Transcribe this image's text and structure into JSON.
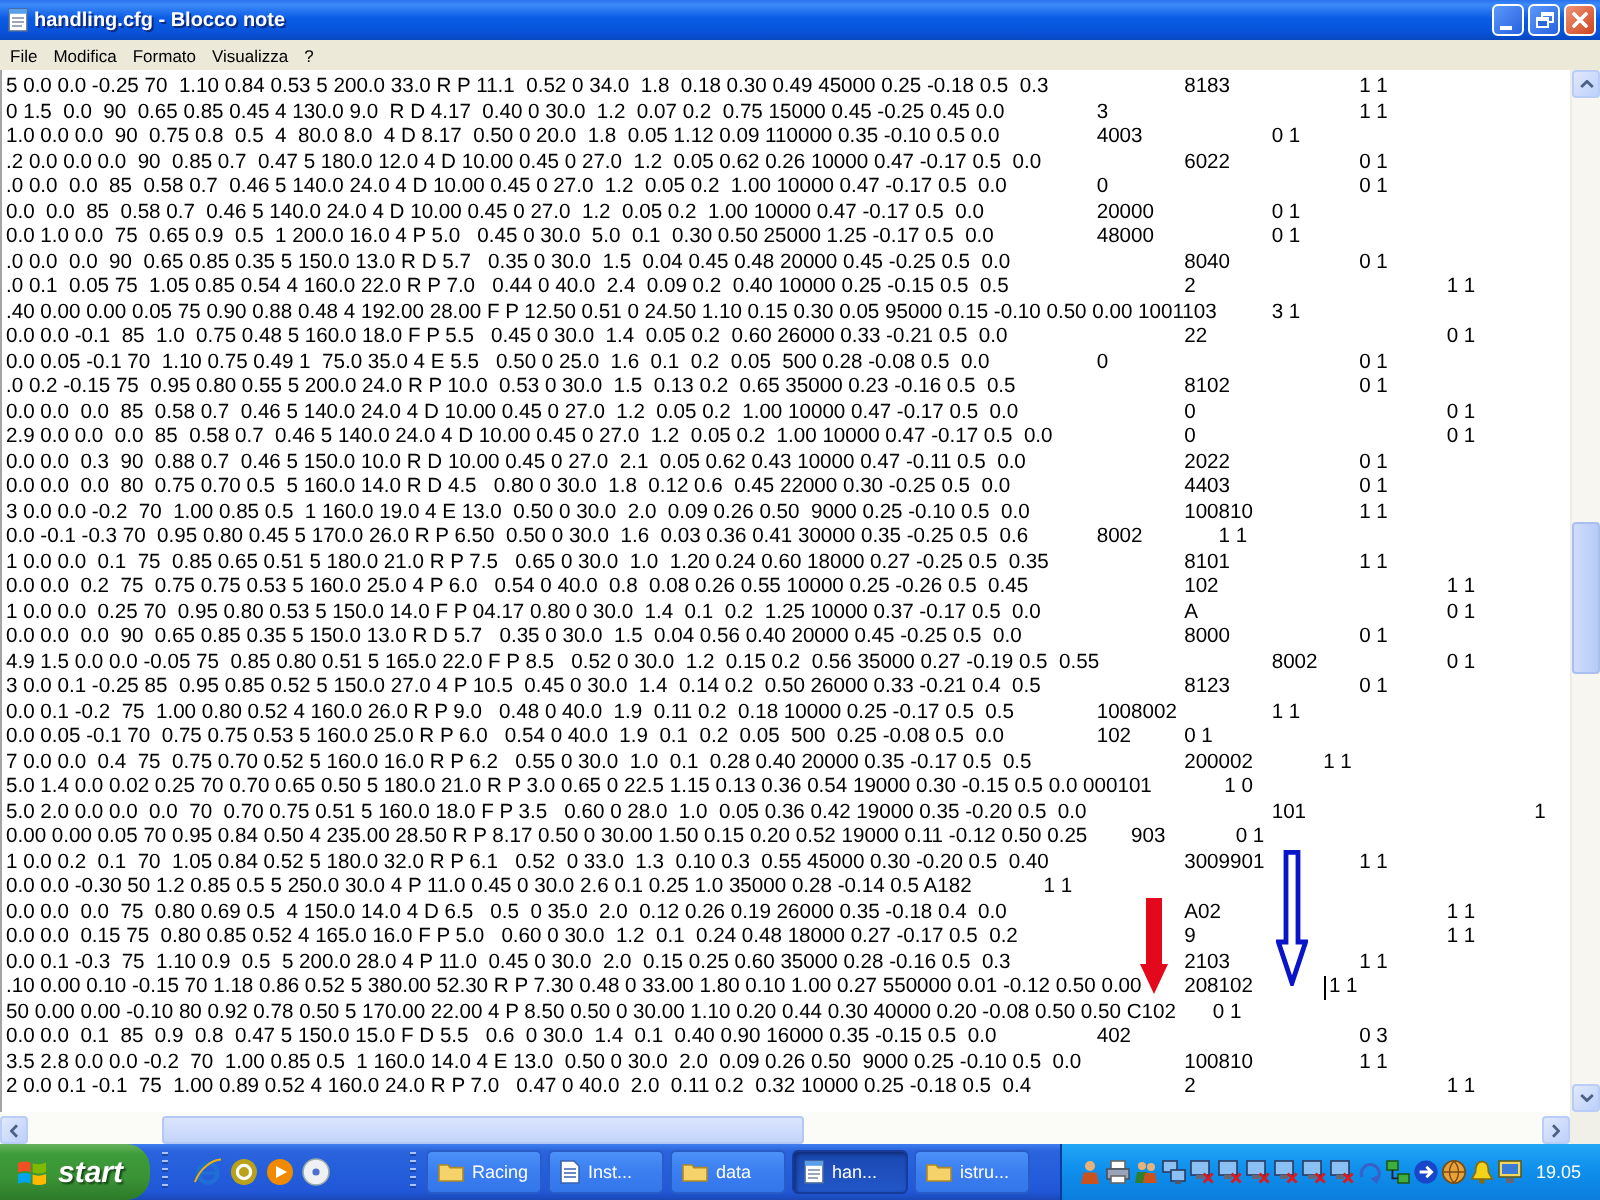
{
  "window": {
    "title": "handling.cfg - Blocco note"
  },
  "menu": [
    "File",
    "Modifica",
    "Formato",
    "Visualizza",
    "?"
  ],
  "lines": [
    {
      "text": "5 0.0 0.0 -0.25 70  1.10 0.84 0.53 5 200.0 33.0 R P 11.1  0.52 0 34.0  1.8  0.18 0.30 0.49 45000 0.25 -0.18 0.5  0.3\t\t8183\t\t1 1",
      "caret": false
    },
    {
      "text": "0 1.5  0.0  90  0.65 0.85 0.45 4 130.0 9.0  R D 4.17  0.40 0 30.0  1.2  0.07 0.2  0.75 15000 0.45 -0.25 0.45 0.0\t\t3\t\t\t1 1",
      "caret": false
    },
    {
      "text": "1.0 0.0 0.0  90  0.75 0.8  0.5  4  80.0 8.0  4 D 8.17  0.50 0 20.0  1.8  0.05 1.12 0.09 110000 0.35 -0.10 0.5 0.0\t\t4003\t\t0 1",
      "caret": false
    },
    {
      "text": ".2 0.0 0.0 0.0  90  0.85 0.7  0.47 5 180.0 12.0 4 D 10.00 0.45 0 27.0  1.2  0.05 0.62 0.26 10000 0.47 -0.17 0.5  0.0\t\t6022\t\t0 1",
      "caret": false
    },
    {
      "text": ".0 0.0  0.0  85  0.58 0.7  0.46 5 140.0 24.0 4 D 10.00 0.45 0 27.0  1.2  0.05 0.2  1.00 10000 0.47 -0.17 0.5  0.0\t\t0\t\t\t0 1",
      "caret": false
    },
    {
      "text": "0.0  0.0  85  0.58 0.7  0.46 5 140.0 24.0 4 D 10.00 0.45 0 27.0  1.2  0.05 0.2  1.00 10000 0.47 -0.17 0.5  0.0\t\t20000\t\t0 1",
      "caret": false
    },
    {
      "text": "0.0 1.0 0.0  75  0.65 0.9  0.5  1 200.0 16.0 4 P 5.0   0.45 0 30.0  5.0  0.1  0.30 0.50 25000 1.25 -0.17 0.5  0.0\t\t48000\t\t0 1",
      "caret": false
    },
    {
      "text": ".0 0.0  0.0  90  0.65 0.85 0.35 5 150.0 13.0 R D 5.7   0.35 0 30.0  1.5  0.04 0.45 0.48 20000 0.45 -0.25 0.5  0.0\t\t8040\t\t0 1",
      "caret": false
    },
    {
      "text": ".0 0.1  0.05 75  1.05 0.85 0.54 4 160.0 22.0 R P 7.0   0.44 0 40.0  2.4  0.09 0.2  0.40 10000 0.25 -0.15 0.5  0.5\t\t2\t\t\t1 1",
      "caret": false
    },
    {
      "text": ".40 0.00 0.00 0.05 75 0.90 0.88 0.48 4 192.00 28.00 F P 12.50 0.51 0 24.50 1.10 0.15 0.30 0.05 95000 0.15 -0.10 0.50 0.00 1001103\t3 1",
      "caret": false
    },
    {
      "text": "0.0 0.0 -0.1  85  1.0  0.75 0.48 5 160.0 18.0 F P 5.5   0.45 0 30.0  1.4  0.05 0.2  0.60 26000 0.33 -0.21 0.5  0.0\t\t\t22\t\t\t0 1",
      "caret": false
    },
    {
      "text": "0.0 0.05 -0.1 70  1.10 0.75 0.49 1  75.0 35.0 4 E 5.5   0.50 0 25.0  1.6  0.1  0.2  0.05  500 0.28 -0.08 0.5  0.0\t\t0\t\t\t0 1",
      "caret": false
    },
    {
      "text": ".0 0.2 -0.15 75  0.95 0.80 0.55 5 200.0 24.0 R P 10.0  0.53 0 30.0  1.5  0.13 0.2  0.65 35000 0.23 -0.16 0.5  0.5\t\t8102\t\t0 1",
      "caret": false
    },
    {
      "text": "0.0 0.0  0.0  85  0.58 0.7  0.46 5 140.0 24.0 4 D 10.00 0.45 0 27.0  1.2  0.05 0.2  1.00 10000 0.47 -0.17 0.5  0.0\t\t0\t\t\t0 1",
      "caret": false
    },
    {
      "text": "2.9 0.0 0.0  0.0  85  0.58 0.7  0.46 5 140.0 24.0 4 D 10.00 0.45 0 27.0  1.2  0.05 0.2  1.00 10000 0.47 -0.17 0.5  0.0\t\t0\t\t\t0 1",
      "caret": false
    },
    {
      "text": "0.0 0.0  0.3  90  0.88 0.7  0.46 5 150.0 10.0 R D 10.00 0.45 0 27.0  2.1  0.05 0.62 0.43 10000 0.47 -0.11 0.5  0.0\t\t2022\t\t0 1",
      "caret": false
    },
    {
      "text": "0.0 0.0  0.0  80  0.75 0.70 0.5  5 160.0 14.0 R D 4.5   0.80 0 30.0  1.8  0.12 0.6  0.45 22000 0.30 -0.25 0.5  0.0\t\t4403\t\t0 1",
      "caret": false
    },
    {
      "text": "3 0.0 0.0 -0.2  70  1.00 0.85 0.5  1 160.0 19.0 4 E 13.0  0.50 0 30.0  2.0  0.09 0.26 0.50  9000 0.25 -0.10 0.5  0.0\t\t100810\t\t1 1",
      "caret": false
    },
    {
      "text": "0.0 -0.1 -0.3 70  0.95 0.80 0.45 5 170.0 26.0 R P 6.50  0.50 0 30.0  1.6  0.03 0.36 0.41 30000 0.35 -0.25 0.5  0.6\t8002\t      1 1",
      "caret": false
    },
    {
      "text": "1 0.0 0.0  0.1  75  0.85 0.65 0.51 5 180.0 21.0 R P 7.5   0.65 0 30.0  1.0  1.20 0.24 0.60 18000 0.27 -0.25 0.5  0.35\t\t8101\t\t1 1",
      "caret": false
    },
    {
      "text": "0.0 0.0  0.2  75  0.75 0.75 0.53 5 160.0 25.0 4 P 6.0   0.54 0 40.0  0.8  0.08 0.26 0.55 10000 0.25 -0.26 0.5  0.45\t\t102\t\t\t1 1",
      "caret": false
    },
    {
      "text": "1 0.0 0.0  0.25 70  0.95 0.80 0.53 5 150.0 14.0 F P 04.17 0.80 0 30.0  1.4  0.1  0.2  1.25 10000 0.37 -0.17 0.5  0.0\t\tA\t\t\t0 1",
      "caret": false
    },
    {
      "text": "0.0 0.0  0.0  90  0.65 0.85 0.35 5 150.0 13.0 R D 5.7   0.35 0 30.0  1.5  0.04 0.56 0.40 20000 0.45 -0.25 0.5  0.0\t\t8000\t\t0 1",
      "caret": false
    },
    {
      "text": "4.9 1.5 0.0 0.0 -0.05 75  0.85 0.80 0.51 5 165.0 22.0 F P 8.5   0.52 0 30.0  1.2  0.15 0.2  0.56 35000 0.27 -0.19 0.5  0.55\t\t8002\t\t0 1",
      "caret": false
    },
    {
      "text": "3 0.0 0.1 -0.25 85  0.95 0.85 0.52 5 150.0 27.0 4 P 10.5  0.45 0 30.0  1.4  0.14 0.2  0.50 26000 0.33 -0.21 0.4  0.5\t\t8123\t\t0 1",
      "caret": false
    },
    {
      "text": "0.0 0.1 -0.2  75  1.00 0.80 0.52 4 160.0 26.0 R P 9.0   0.48 0 40.0  1.9  0.11 0.2  0.18 10000 0.25 -0.17 0.5  0.5\t1008002\t\t1 1",
      "caret": false
    },
    {
      "text": "0.0 0.05 -0.1 70  0.75 0.75 0.53 5 160.0 25.0 R P 6.0   0.54 0 40.0  1.9  0.1  0.2  0.05  500  0.25 -0.08 0.5  0.0\t\t102\t0 1",
      "caret": false
    },
    {
      "text": "7 0.0 0.0  0.4  75  0.75 0.70 0.52 5 160.0 16.0 R P 6.2   0.55 0 30.0  1.0  0.1  0.28 0.40 20000 0.35 -0.17 0.5  0.5\t\t200002\t         1 1",
      "caret": false
    },
    {
      "text": "5.0 1.4 0.0 0.02 0.25 70 0.70 0.65 0.50 5 180.0 21.0 R P 3.0 0.65 0 22.5 1.15 0.13 0.36 0.54 19000 0.30 -0.15 0.5 0.0 000101\t       1 0",
      "caret": false
    },
    {
      "text": "5.0 2.0 0.0 0.0  0.0  70  0.70 0.75 0.51 5 160.0 18.0 F P 3.5   0.60 0 28.0  1.0  0.05 0.36 0.42 19000 0.35 -0.20 0.5  0.0\t\t\t101\t\t\t1",
      "caret": false
    },
    {
      "text": "0.00 0.00 0.05 70 0.95 0.84 0.50 4 235.00 28.50 R P 8.17 0.50 0 30.00 1.50 0.15 0.20 0.52 19000 0.11 -0.12 0.50 0.25\t      903\t         0 1",
      "caret": false
    },
    {
      "text": "1 0.0 0.2  0.1  70  1.05 0.84 0.52 5 180.0 32.0 R P 6.1   0.52  0 33.0  1.3  0.10 0.3  0.55 45000 0.30 -0.20 0.5  0.40\t\t3009901\t\t1 1",
      "caret": false
    },
    {
      "text": "0.0 0.0 -0.30 50 1.2 0.85 0.5 5 250.0 30.0 4 P 11.0 0.45 0 30.0 2.6 0.1 0.25 1.0 35000 0.28 -0.14 0.5 A182\t      1 1",
      "caret": false
    },
    {
      "text": "0.0 0.0  0.0  75  0.80 0.69 0.5  4 150.0 14.0 4 D 6.5   0.5  0 35.0  2.0  0.12 0.26 0.19 26000 0.35 -0.18 0.4  0.0\t\t\tA02\t\t\t1 1",
      "caret": false
    },
    {
      "text": "0.0 0.0  0.15 75  0.80 0.85 0.52 4 165.0 16.0 F P 5.0   0.60 0 30.0  1.2  0.1  0.24 0.48 18000 0.27 -0.17 0.5  0.2\t\t9\t\t\t1 1",
      "caret": false
    },
    {
      "text": "0.0 0.1 -0.3  75  1.10 0.9  0.5  5 200.0 28.0 4 P 11.0  0.45 0 30.0  2.0  0.15 0.25 0.60 35000 0.28 -0.16 0.5  0.3\t\t2103\t\t1 1",
      "caret": false
    },
    {
      "text": ".10 0.00 0.10 -0.15 70 1.18 0.86 0.52 5 380.00 52.30 R P 7.30 0.48 0 33.00 1.80 0.10 1.00 0.27 550000 0.01 -0.12 0.50 0.00\t208102\t          1 1",
      "caret": true
    },
    {
      "text": "50 0.00 0.00 -0.10 80 0.92 0.78 0.50 5 170.00 22.00 4 P 8.50 0.50 0 30.00 1.10 0.20 0.44 0.30 40000 0.20 -0.08 0.50 0.50 C102\t     0 1",
      "caret": false
    },
    {
      "text": "0.0 0.0  0.1  85  0.9  0.8  0.47 5 150.0 15.0 F D 5.5   0.6  0 30.0  1.4  0.1  0.40 0.90 16000 0.35 -0.15 0.5  0.0\t\t402\t\t\t0 3",
      "caret": false
    },
    {
      "text": "3.5 2.8 0.0 0.0 -0.2  70  1.00 0.85 0.5  1 160.0 14.0 4 E 13.0  0.50 0 30.0  2.0  0.09 0.26 0.50  9000 0.25 -0.10 0.5  0.0\t\t100810\t\t1 1",
      "caret": false
    },
    {
      "text": "2 0.0 0.1 -0.1  75  1.00 0.89 0.52 4 160.0 24.0 R P 7.0   0.47 0 40.0  2.0  0.11 0.2  0.32 10000 0.25 -0.18 0.5  0.4\t\t2\t\t\t1 1",
      "caret": false
    }
  ],
  "annotation_arrows": [
    {
      "kind": "filled",
      "color": "#e4081c"
    },
    {
      "kind": "outline",
      "color": "#0a14c8"
    }
  ],
  "taskbar": {
    "start": "start",
    "tasks": [
      {
        "label": "Racing",
        "kind": "folder",
        "selected": false
      },
      {
        "label": "Inst...",
        "kind": "document",
        "selected": false
      },
      {
        "label": "data",
        "kind": "folder",
        "selected": false
      },
      {
        "label": "han...",
        "kind": "notepad",
        "selected": true
      },
      {
        "label": "istru...",
        "kind": "folder",
        "selected": false
      }
    ],
    "clock": "19.05"
  }
}
